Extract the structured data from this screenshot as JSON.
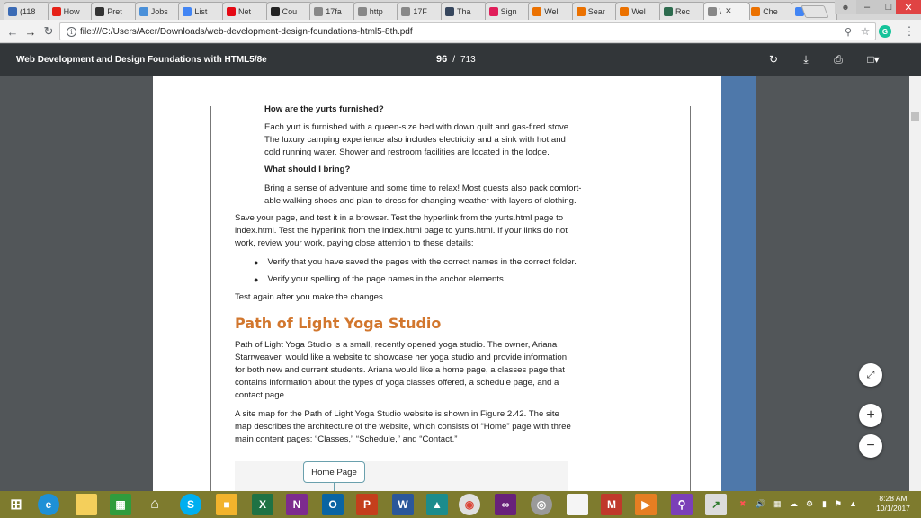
{
  "browser": {
    "tabs": [
      {
        "label": "(118",
        "icon": "mail-icon",
        "color": "#3b6bb5"
      },
      {
        "label": "How",
        "icon": "youtube-icon",
        "color": "#e62117"
      },
      {
        "label": "Pret",
        "icon": "wikipedia-icon",
        "color": "#333333"
      },
      {
        "label": "Jobs",
        "icon": "jobs-icon",
        "color": "#4a90d9"
      },
      {
        "label": "List",
        "icon": "google-icon",
        "color": "#4285f4"
      },
      {
        "label": "Net",
        "icon": "netflix-icon",
        "color": "#e50914"
      },
      {
        "label": "Cou",
        "icon": "blackboard-icon",
        "color": "#222222"
      },
      {
        "label": "17fa",
        "icon": "page-icon",
        "color": "#888888"
      },
      {
        "label": "http",
        "icon": "page-icon",
        "color": "#888888"
      },
      {
        "label": "17F",
        "icon": "page-icon",
        "color": "#888888"
      },
      {
        "label": "Tha",
        "icon": "tumblr-icon",
        "color": "#36465d"
      },
      {
        "label": "Sign",
        "icon": "slack-icon",
        "color": "#e01e5a"
      },
      {
        "label": "Wel",
        "icon": "chegg-icon",
        "color": "#eb7100"
      },
      {
        "label": "Sear",
        "icon": "chegg-icon",
        "color": "#eb7100"
      },
      {
        "label": "Wel",
        "icon": "chegg-icon",
        "color": "#eb7100"
      },
      {
        "label": "Rec",
        "icon": "b-icon",
        "color": "#2d6b4e"
      },
      {
        "label": "\\",
        "icon": "page-icon",
        "color": "#888888",
        "active": true
      },
      {
        "label": "Che",
        "icon": "chegg-icon",
        "color": "#eb7100"
      },
      {
        "label": "how",
        "icon": "google-icon",
        "color": "#4285f4"
      }
    ],
    "url": "file:///C:/Users/Acer/Downloads/web-development-design-foundations-html5-8th.pdf"
  },
  "pdf": {
    "title": "Web Development and Design Foundations with HTML5/8e",
    "current_page": "96",
    "separator": "/",
    "total_pages": "713"
  },
  "content": {
    "q1_heading": "How are the yurts furnished?",
    "q1_lines": [
      "Each yurt is furnished with a queen-size bed with down quilt and gas-fired stove.",
      "The luxury camping experience also includes electricity and a sink with hot and",
      "cold running water. Shower and restroom facilities are located in the lodge."
    ],
    "q2_heading": "What should I bring?",
    "q2_lines": [
      "Bring a sense of adventure and some time to relax! Most guests also pack comfort-",
      "able walking shoes and plan to dress for changing weather with layers of clothing."
    ],
    "save_lines": [
      "Save your page, and test it in a browser. Test the hyperlink from the yurts.html page to",
      "index.html. Test the hyperlink from the index.html page to yurts.html. If your links do not",
      "work, review your work, paying close attention to these details:"
    ],
    "bullets": [
      "Verify that you have saved the pages with the correct names in the correct folder.",
      "Verify your spelling of the page names in the anchor elements."
    ],
    "test_again": "Test again after you make the changes.",
    "section_heading": "Path of Light Yoga Studio",
    "yoga_lines": [
      "Path of Light Yoga Studio is a small, recently opened yoga studio. The owner, Ariana",
      "Starrweaver, would like a website to showcase her yoga studio and provide information",
      "for both new and current students. Ariana would like a home page, a classes page that",
      "contains information about the types of yoga classes offered, a schedule page, and a",
      "contact page."
    ],
    "sitemap_lines": [
      "A site map for the Path of Light Yoga Studio website is shown in Figure 2.42. The site",
      "map describes the architecture of the website, which consists of “Home” page with three",
      "main content pages: “Classes,” “Schedule,” and “Contact.”"
    ],
    "home_page_box": "Home Page"
  },
  "clock": {
    "time": "8:28 AM",
    "date": "10/1/2017"
  }
}
